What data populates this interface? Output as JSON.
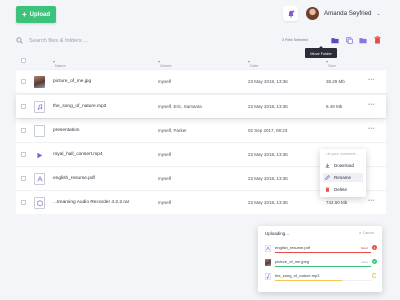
{
  "topbar": {
    "upload_label": "Upload",
    "user_name": "Amanda Seyfried"
  },
  "search": {
    "placeholder": "Search files & folders ..."
  },
  "toolbar": {
    "selected_text": "3 Files Selected",
    "tooltip": "Move Folder"
  },
  "table": {
    "headers": {
      "name": "Name",
      "owner": "Owner",
      "date": "Date",
      "size": "Size"
    },
    "rows": [
      {
        "name": "picture_of_me.jpg",
        "owner": "myself",
        "date": "23 May 2018, 13:36",
        "size": "38.29 Mb",
        "thumb": "photo"
      },
      {
        "name": "the_song_of_nature.mp3",
        "owner": "myself, Eric, Samanta",
        "date": "23 May 2018, 13:36",
        "size": "8.49 Mb",
        "thumb": "music"
      },
      {
        "name": "presentation",
        "owner": "myself, Parker",
        "date": "02 Sep 2017, 09:23",
        "size": "",
        "thumb": "folder"
      },
      {
        "name": "royal_hall_consert.mp4",
        "owner": "myself",
        "date": "23 May 2018, 13:36",
        "size": "",
        "thumb": "video"
      },
      {
        "name": "english_resume.pdf",
        "owner": "myself",
        "date": "23 May 2018, 13:36",
        "size": "",
        "thumb": "pdf"
      },
      {
        "name": "...treaming Audio Recorder 4.2.2.rar",
        "owner": "myself",
        "date": "23 May 2018, 13:36",
        "size": "742.60 Mb",
        "thumb": "rar"
      }
    ],
    "more_label": "•••"
  },
  "context_menu": {
    "input_placeholder": "...at your comment...",
    "items": [
      "Download",
      "Rename",
      "Delete"
    ]
  },
  "uploads": {
    "title": "Uploading...",
    "cancel_label": "✕ Cancel",
    "items": [
      {
        "name": "english_resume.pdf",
        "status": "failed",
        "progress": 1.0,
        "color": "#e94b4b",
        "mark": "!"
      },
      {
        "name": "picture_of_me.jpeg",
        "status": "done",
        "progress": 1.0,
        "color": "#3cc27a",
        "mark": "✓"
      },
      {
        "name": "the_song_of_nature.mp3",
        "status": "",
        "progress": 0.7,
        "color": "#f2c94c",
        "mark": ""
      }
    ]
  },
  "colors": {
    "accent": "#3cc27a",
    "brand_purple": "#7b61d9",
    "danger": "#e94b4b",
    "warning": "#f2c94c"
  }
}
